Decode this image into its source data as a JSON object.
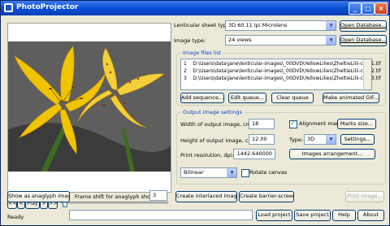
{
  "window": {
    "title": "PhotoProjector"
  },
  "lenticular": {
    "sheet_label": "Lenticular sheet type:",
    "sheet_value": "3D 60.11 lpi Microlens",
    "open_database_label": "Open Database...",
    "image_type_label": "Image type:",
    "image_type_value": "24 views",
    "open_database2_label": "Open Database..."
  },
  "files": {
    "group_title": "Image files list",
    "rows": [
      {
        "num": "1",
        "path": "D:\\Users\\data\\jane\\lenticular-images\\_00DVD\\YellowLilies\\ZheltieLilii-crop1.tif"
      },
      {
        "num": "2",
        "path": "D:\\Users\\data\\jane\\lenticular-images\\_00DVD\\YellowLilies\\ZheltieLilii-crop2.tif"
      },
      {
        "num": "3",
        "path": "D:\\Users\\data\\jane\\lenticular-images\\_00DVD\\YellowLilies\\ZheltieLilii-crop3.tif"
      }
    ],
    "add_sequence_label": "Add sequence...",
    "edit_queue_label": "Edit queue...",
    "clear_queue_label": "Clear queue",
    "make_gif_label": "Make animated GIF..."
  },
  "output": {
    "group_title": "Output image settings",
    "width_label": "Width of output image, cm:",
    "width_value": "18",
    "height_label": "Height of output image, cm:",
    "height_value": "12.00",
    "resolution_label": "Print resolution, dpi:",
    "resolution_value": "1442.640000",
    "alignment_label": "Alignment marks",
    "alignment_checked": true,
    "marks_size_label": "Marks size...",
    "type_label": "Type:",
    "type_value": "3D",
    "settings_label": "Settings...",
    "arrangement_label": "Images arrangement...",
    "interp_value": "Bilinear",
    "rotate_label": "Rotate canvas",
    "rotate_checked": false
  },
  "playback": {
    "first_label": "<<",
    "prev_label": "<",
    "play_label": "Play",
    "next_label": ">",
    "last_label": ">>",
    "slider_position": 0.0
  },
  "bottom": {
    "anaglyph_label": "Show as anaglyph image",
    "frame_shift_label": "Frame shift for anaglyph show:",
    "frame_shift_value": "3",
    "create_interlaced_label": "Create interlaced image",
    "create_barrier_label": "Create barrier-screen",
    "print_label": "Print image..."
  },
  "status": {
    "text": "Ready",
    "load_label": "Load project",
    "save_label": "Save project",
    "help_label": "Help",
    "about_label": "About"
  }
}
